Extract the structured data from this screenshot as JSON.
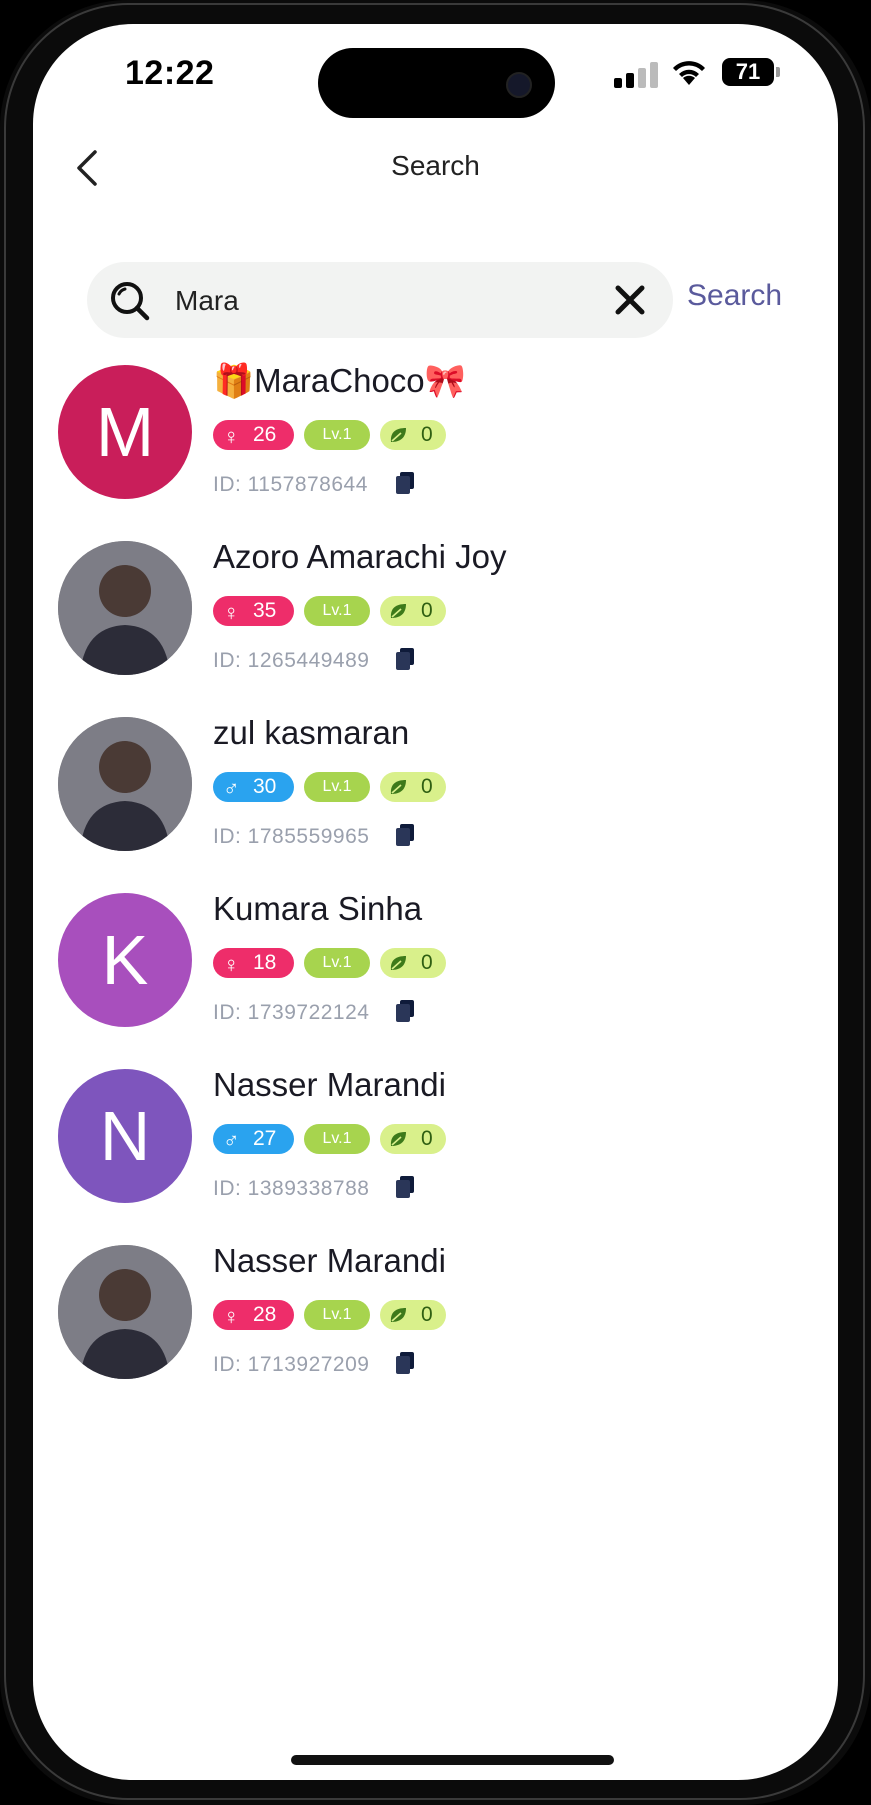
{
  "status_bar": {
    "time": "12:22",
    "battery": "71"
  },
  "header": {
    "title": "Search"
  },
  "search": {
    "value": "Mara",
    "button_label": "Search"
  },
  "colors": {
    "female": "#ee2d6a",
    "male": "#2aa3ef",
    "level": "#a7d44e",
    "leaf": "#d9f08b",
    "search_button": "#5a5a9c"
  },
  "results": [
    {
      "name": "🎁MaraChoco🎀",
      "gender": "female",
      "gender_symbol": "♀",
      "age": "26",
      "level": "Lv.1",
      "leaf_count": "0",
      "id_text": "ID: 1157878644",
      "avatar": {
        "type": "letter",
        "letter": "M",
        "color": "#c91e5a"
      }
    },
    {
      "name": "Azoro Amarachi Joy",
      "gender": "female",
      "gender_symbol": "♀",
      "age": "35",
      "level": "Lv.1",
      "leaf_count": "0",
      "id_text": "ID: 1265449489",
      "avatar": {
        "type": "photo"
      }
    },
    {
      "name": "zul kasmaran",
      "gender": "male",
      "gender_symbol": "♂",
      "age": "30",
      "level": "Lv.1",
      "leaf_count": "0",
      "id_text": "ID: 1785559965",
      "avatar": {
        "type": "photo"
      }
    },
    {
      "name": "Kumara Sinha",
      "gender": "female",
      "gender_symbol": "♀",
      "age": "18",
      "level": "Lv.1",
      "leaf_count": "0",
      "id_text": "ID: 1739722124",
      "avatar": {
        "type": "letter",
        "letter": "K",
        "color": "#a84fbd"
      }
    },
    {
      "name": "Nasser Marandi",
      "gender": "male",
      "gender_symbol": "♂",
      "age": "27",
      "level": "Lv.1",
      "leaf_count": "0",
      "id_text": "ID: 1389338788",
      "avatar": {
        "type": "letter",
        "letter": "N",
        "color": "#7e55bd"
      }
    },
    {
      "name": "Nasser Marandi",
      "gender": "female",
      "gender_symbol": "♀",
      "age": "28",
      "level": "Lv.1",
      "leaf_count": "0",
      "id_text": "ID: 1713927209",
      "avatar": {
        "type": "photo"
      }
    }
  ]
}
